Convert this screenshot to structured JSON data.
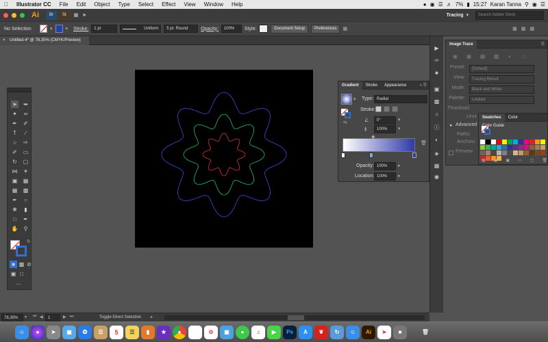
{
  "menubar": {
    "apple": "",
    "app": "Illustrator CC",
    "items": [
      "File",
      "Edit",
      "Object",
      "Type",
      "Select",
      "Effect",
      "View",
      "Window",
      "Help"
    ],
    "battery": "7%",
    "time": "15:27",
    "user": "Karan Tanna"
  },
  "appbar": {
    "logo": "Ai",
    "br": "Br",
    "st": "St",
    "workspace": "Tracing",
    "search_placeholder": "Search Adobe Stock"
  },
  "control": {
    "selection": "No Selection",
    "stroke_label": "Stroke:",
    "stroke_value": "1 pt",
    "profile": "Uniform",
    "brush": "5 pt. Round",
    "opacity_label": "Opacity:",
    "opacity_value": "100%",
    "style_label": "Style:",
    "doc_setup": "Document Setup",
    "preferences": "Preferences"
  },
  "doc": {
    "tab": "Untitled-4* @ 78,35% (CMYK/Preview)",
    "zoom": "78,35%",
    "page": "1",
    "status": "Toggle Direct Selection"
  },
  "trace": {
    "title": "Image Trace",
    "rows": [
      {
        "label": "Preset:",
        "value": "[Default]"
      },
      {
        "label": "View:",
        "value": "Tracing Result"
      },
      {
        "label": "Mode:",
        "value": "Black and White"
      },
      {
        "label": "Palette:",
        "value": "Limited"
      }
    ],
    "threshold": "Threshold:",
    "less": "Less",
    "advanced": "Advanced",
    "paths": "Paths:",
    "anchors": "Anchors:",
    "preview": "Preview"
  },
  "gradient": {
    "tabs": [
      "Gradient",
      "Stroke",
      "Appearance"
    ],
    "type_label": "Type:",
    "type_value": "Radial",
    "stroke_label": "Stroke:",
    "angle": "0°",
    "aspect": "100%",
    "opacity_label": "Opacity:",
    "opacity_value": "100%",
    "location_label": "Location:",
    "location_value": "100%"
  },
  "swatches": {
    "tabs": [
      "Swatches",
      "Color",
      "Color Guide"
    ],
    "colors": [
      "#ffffff",
      "#000000",
      "#ffffff",
      "#e30613",
      "#ffed00",
      "#00a650",
      "#00aeef",
      "#2e3192",
      "#ec008c",
      "#ed1c24",
      "#f7941d",
      "#fff200",
      "#8dc63f",
      "#39b54a",
      "#00a99d",
      "#27aae1",
      "#1c75bc",
      "#2e3192",
      "#662d91",
      "#92278f",
      "#ec008c",
      "#8b5e3c",
      "#a67c52",
      "#c69c6d",
      "#736357",
      "#998675",
      "#534741",
      "#b3b3b3",
      "#808080",
      "#4d4d4d",
      "#d4b896",
      "#c49a6c",
      "#8c6239",
      "#603813",
      "#754c24",
      "#a0410d",
      "#c1272d",
      "#f15a24",
      "#f7931e",
      "#fbb03b"
    ]
  },
  "dock": {
    "icons": [
      "Finder",
      "Siri",
      "Launchpad",
      "Preview",
      "Safari",
      "Notes",
      "Calendar",
      "Notes2",
      "iBooks",
      "Stars",
      "Chrome",
      "Stickies",
      "Photos",
      "Photo",
      "Messages",
      "iTunes",
      "FaceTime",
      "Photoshop",
      "App Store",
      "Acrobat",
      "Migration",
      "Finder2",
      "Illustrator",
      "Pointer",
      "Trash"
    ],
    "calendar_day": "5",
    "ps": "Ps",
    "ai": "Ai"
  }
}
